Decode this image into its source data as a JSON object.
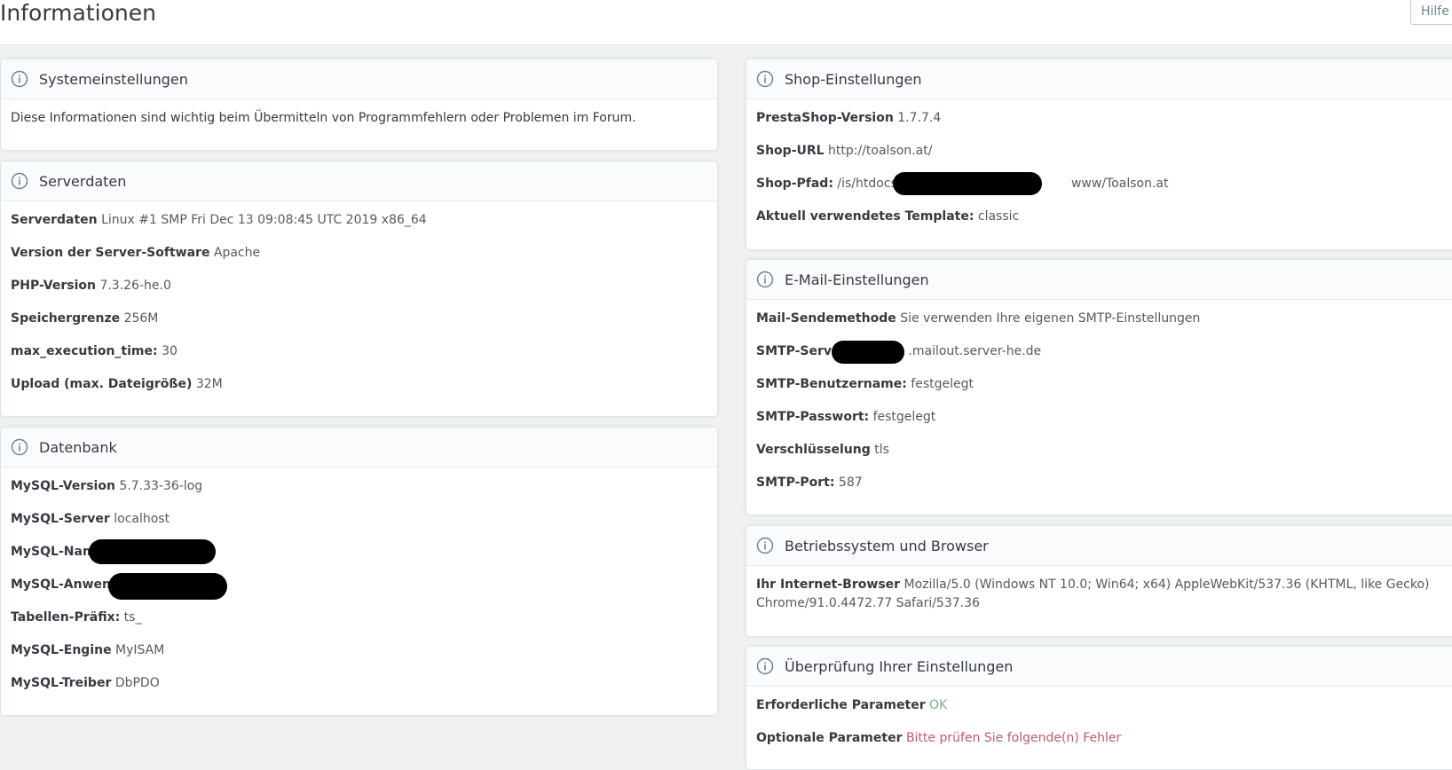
{
  "header": {
    "title": "Informationen",
    "help_label": "Hilfe"
  },
  "system_settings": {
    "title": "Systemeinstellungen",
    "description": "Diese Informationen sind wichtig beim Übermitteln von Programmfehlern oder Problemen im Forum."
  },
  "server_data": {
    "title": "Serverdaten",
    "rows": [
      {
        "label": "Serverdaten",
        "value": "Linux #1 SMP Fri Dec 13 09:08:45 UTC 2019 x86_64"
      },
      {
        "label": "Version der Server-Software",
        "value": "Apache"
      },
      {
        "label": "PHP-Version",
        "value": "7.3.26-he.0"
      },
      {
        "label": "Speichergrenze",
        "value": "256M"
      },
      {
        "label": "max_execution_time:",
        "value": "30"
      },
      {
        "label": "Upload (max. Dateigröße)",
        "value": "32M"
      }
    ]
  },
  "database": {
    "title": "Datenbank",
    "rows": [
      {
        "label": "MySQL-Version",
        "value": "5.7.33-36-log"
      },
      {
        "label": "MySQL-Server",
        "value": "localhost"
      },
      {
        "label": "MySQL-Name",
        "value": ""
      },
      {
        "label": "MySQL-Anwender",
        "value": ""
      },
      {
        "label": "Tabellen-Präfix:",
        "value": "ts_"
      },
      {
        "label": "MySQL-Engine",
        "value": "MyISAM"
      },
      {
        "label": "MySQL-Treiber",
        "value": "DbPDO"
      }
    ]
  },
  "shop_settings": {
    "title": "Shop-Einstellungen",
    "rows": [
      {
        "label": "PrestaShop-Version",
        "value": "1.7.7.4"
      },
      {
        "label": "Shop-URL",
        "value": "http://toalson.at/"
      },
      {
        "label": "Shop-Pfad:",
        "value": "/is/htdocs/w",
        "value_suffix": "www/Toalson.at"
      },
      {
        "label": "Aktuell verwendetes Template:",
        "value": "classic"
      }
    ]
  },
  "email_settings": {
    "title": "E-Mail-Einstellungen",
    "rows": [
      {
        "label": "Mail-Sendemethode",
        "value": "Sie verwenden Ihre eigenen SMTP-Einstellungen"
      },
      {
        "label": "SMTP-Server",
        "value": ".mailout.server-he.de"
      },
      {
        "label": "SMTP-Benutzername:",
        "value": "festgelegt"
      },
      {
        "label": "SMTP-Passwort:",
        "value": "festgelegt"
      },
      {
        "label": "Verschlüsselung",
        "value": "tls"
      },
      {
        "label": "SMTP-Port:",
        "value": "587"
      }
    ]
  },
  "os_browser": {
    "title": "Betriebssystem und Browser",
    "browser_label": "Ihr Internet-Browser",
    "browser_value": "Mozilla/5.0 (Windows NT 10.0; Win64; x64) AppleWebKit/537.36 (KHTML, like Gecko) Chrome/91.0.4472.77 Safari/537.36"
  },
  "check_settings": {
    "title": "Überprüfung Ihrer Einstellungen",
    "required_label": "Erforderliche Parameter",
    "required_value": "OK",
    "optional_label": "Optionale Parameter",
    "optional_value": "Bitte prüfen Sie folgende(n) Fehler"
  },
  "colors": {
    "ok": "#70b580",
    "error": "#c05c67",
    "background": "#eff1f2"
  },
  "icons": {
    "panel_heading": "info-circle-icon"
  }
}
